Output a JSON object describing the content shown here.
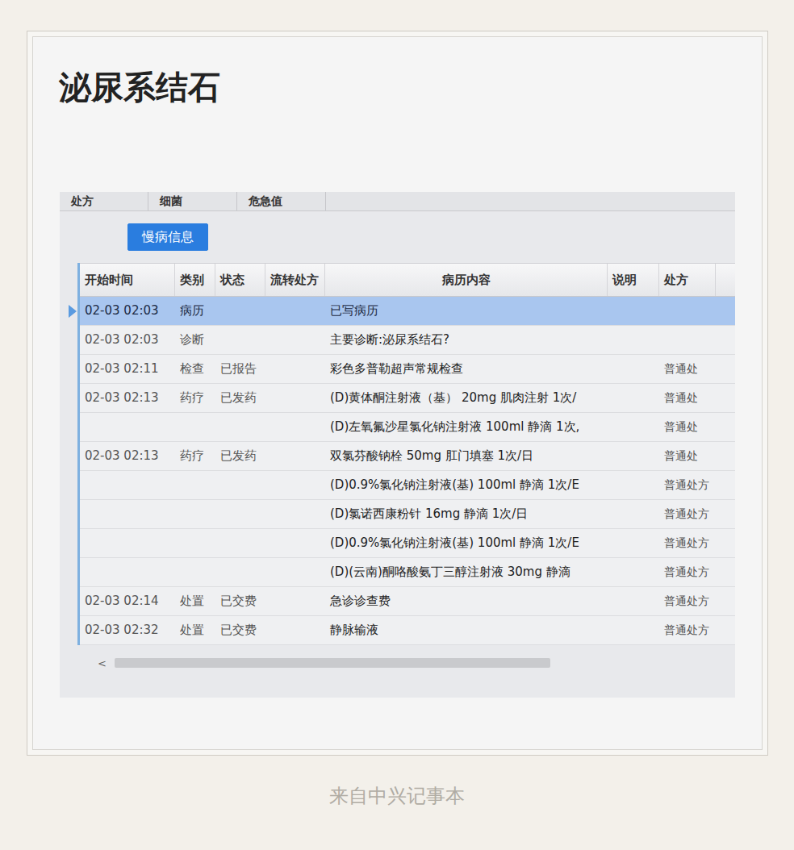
{
  "title": "泌尿系结石",
  "photo": {
    "tabs": [
      "处方",
      "细菌",
      "危急值"
    ],
    "button": "慢病信息",
    "table": {
      "columns": [
        "开始时间",
        "类别",
        "状态",
        "流转处方",
        "病历内容",
        "说明",
        "处方"
      ],
      "rows": [
        {
          "time": "02-03 02:03",
          "category": "病历",
          "status": "",
          "flow": "",
          "content": "已写病历",
          "note": "",
          "rx": "",
          "selected": true
        },
        {
          "time": "02-03 02:03",
          "category": "诊断",
          "status": "",
          "flow": "",
          "content": "主要诊断:泌尿系结石?",
          "note": "",
          "rx": "",
          "selected": false
        },
        {
          "time": "02-03 02:11",
          "category": "检查",
          "status": "已报告",
          "flow": "",
          "content": "彩色多普勒超声常规检查",
          "note": "",
          "rx": "普通处",
          "selected": false
        },
        {
          "time": "02-03 02:13",
          "category": "药疗",
          "status": "已发药",
          "flow": "",
          "content": "(D)黄体酮注射液（基） 20mg 肌肉注射 1次/",
          "note": "",
          "rx": "普通处",
          "selected": false
        },
        {
          "time": "",
          "category": "",
          "status": "",
          "flow": "",
          "content": "(D)左氧氟沙星氯化钠注射液 100ml 静滴 1次,",
          "note": "",
          "rx": "普通处",
          "selected": false
        },
        {
          "time": "02-03 02:13",
          "category": "药疗",
          "status": "已发药",
          "flow": "",
          "content": "双氯芬酸钠栓 50mg 肛门填塞 1次/日",
          "note": "",
          "rx": "普通处",
          "selected": false
        },
        {
          "time": "",
          "category": "",
          "status": "",
          "flow": "",
          "content": "(D)0.9%氯化钠注射液(基) 100ml 静滴 1次/E",
          "note": "",
          "rx": "普通处方",
          "selected": false
        },
        {
          "time": "",
          "category": "",
          "status": "",
          "flow": "",
          "content": "(D)氯诺西康粉针 16mg 静滴 1次/日",
          "note": "",
          "rx": "普通处方",
          "selected": false
        },
        {
          "time": "",
          "category": "",
          "status": "",
          "flow": "",
          "content": "(D)0.9%氯化钠注射液(基) 100ml 静滴 1次/E",
          "note": "",
          "rx": "普通处方",
          "selected": false
        },
        {
          "time": "",
          "category": "",
          "status": "",
          "flow": "",
          "content": "(D)(云南)酮咯酸氨丁三醇注射液 30mg 静滴",
          "note": "",
          "rx": "普通处方",
          "selected": false
        },
        {
          "time": "02-03 02:14",
          "category": "处置",
          "status": "已交费",
          "flow": "",
          "content": "急诊诊查费",
          "note": "",
          "rx": "普通处方",
          "selected": false
        },
        {
          "time": "02-03 02:32",
          "category": "处置",
          "status": "已交费",
          "flow": "",
          "content": "静脉输液",
          "note": "",
          "rx": "普通处方",
          "selected": false
        }
      ]
    },
    "scroll_left": "<"
  },
  "footer": "来自中兴记事本"
}
